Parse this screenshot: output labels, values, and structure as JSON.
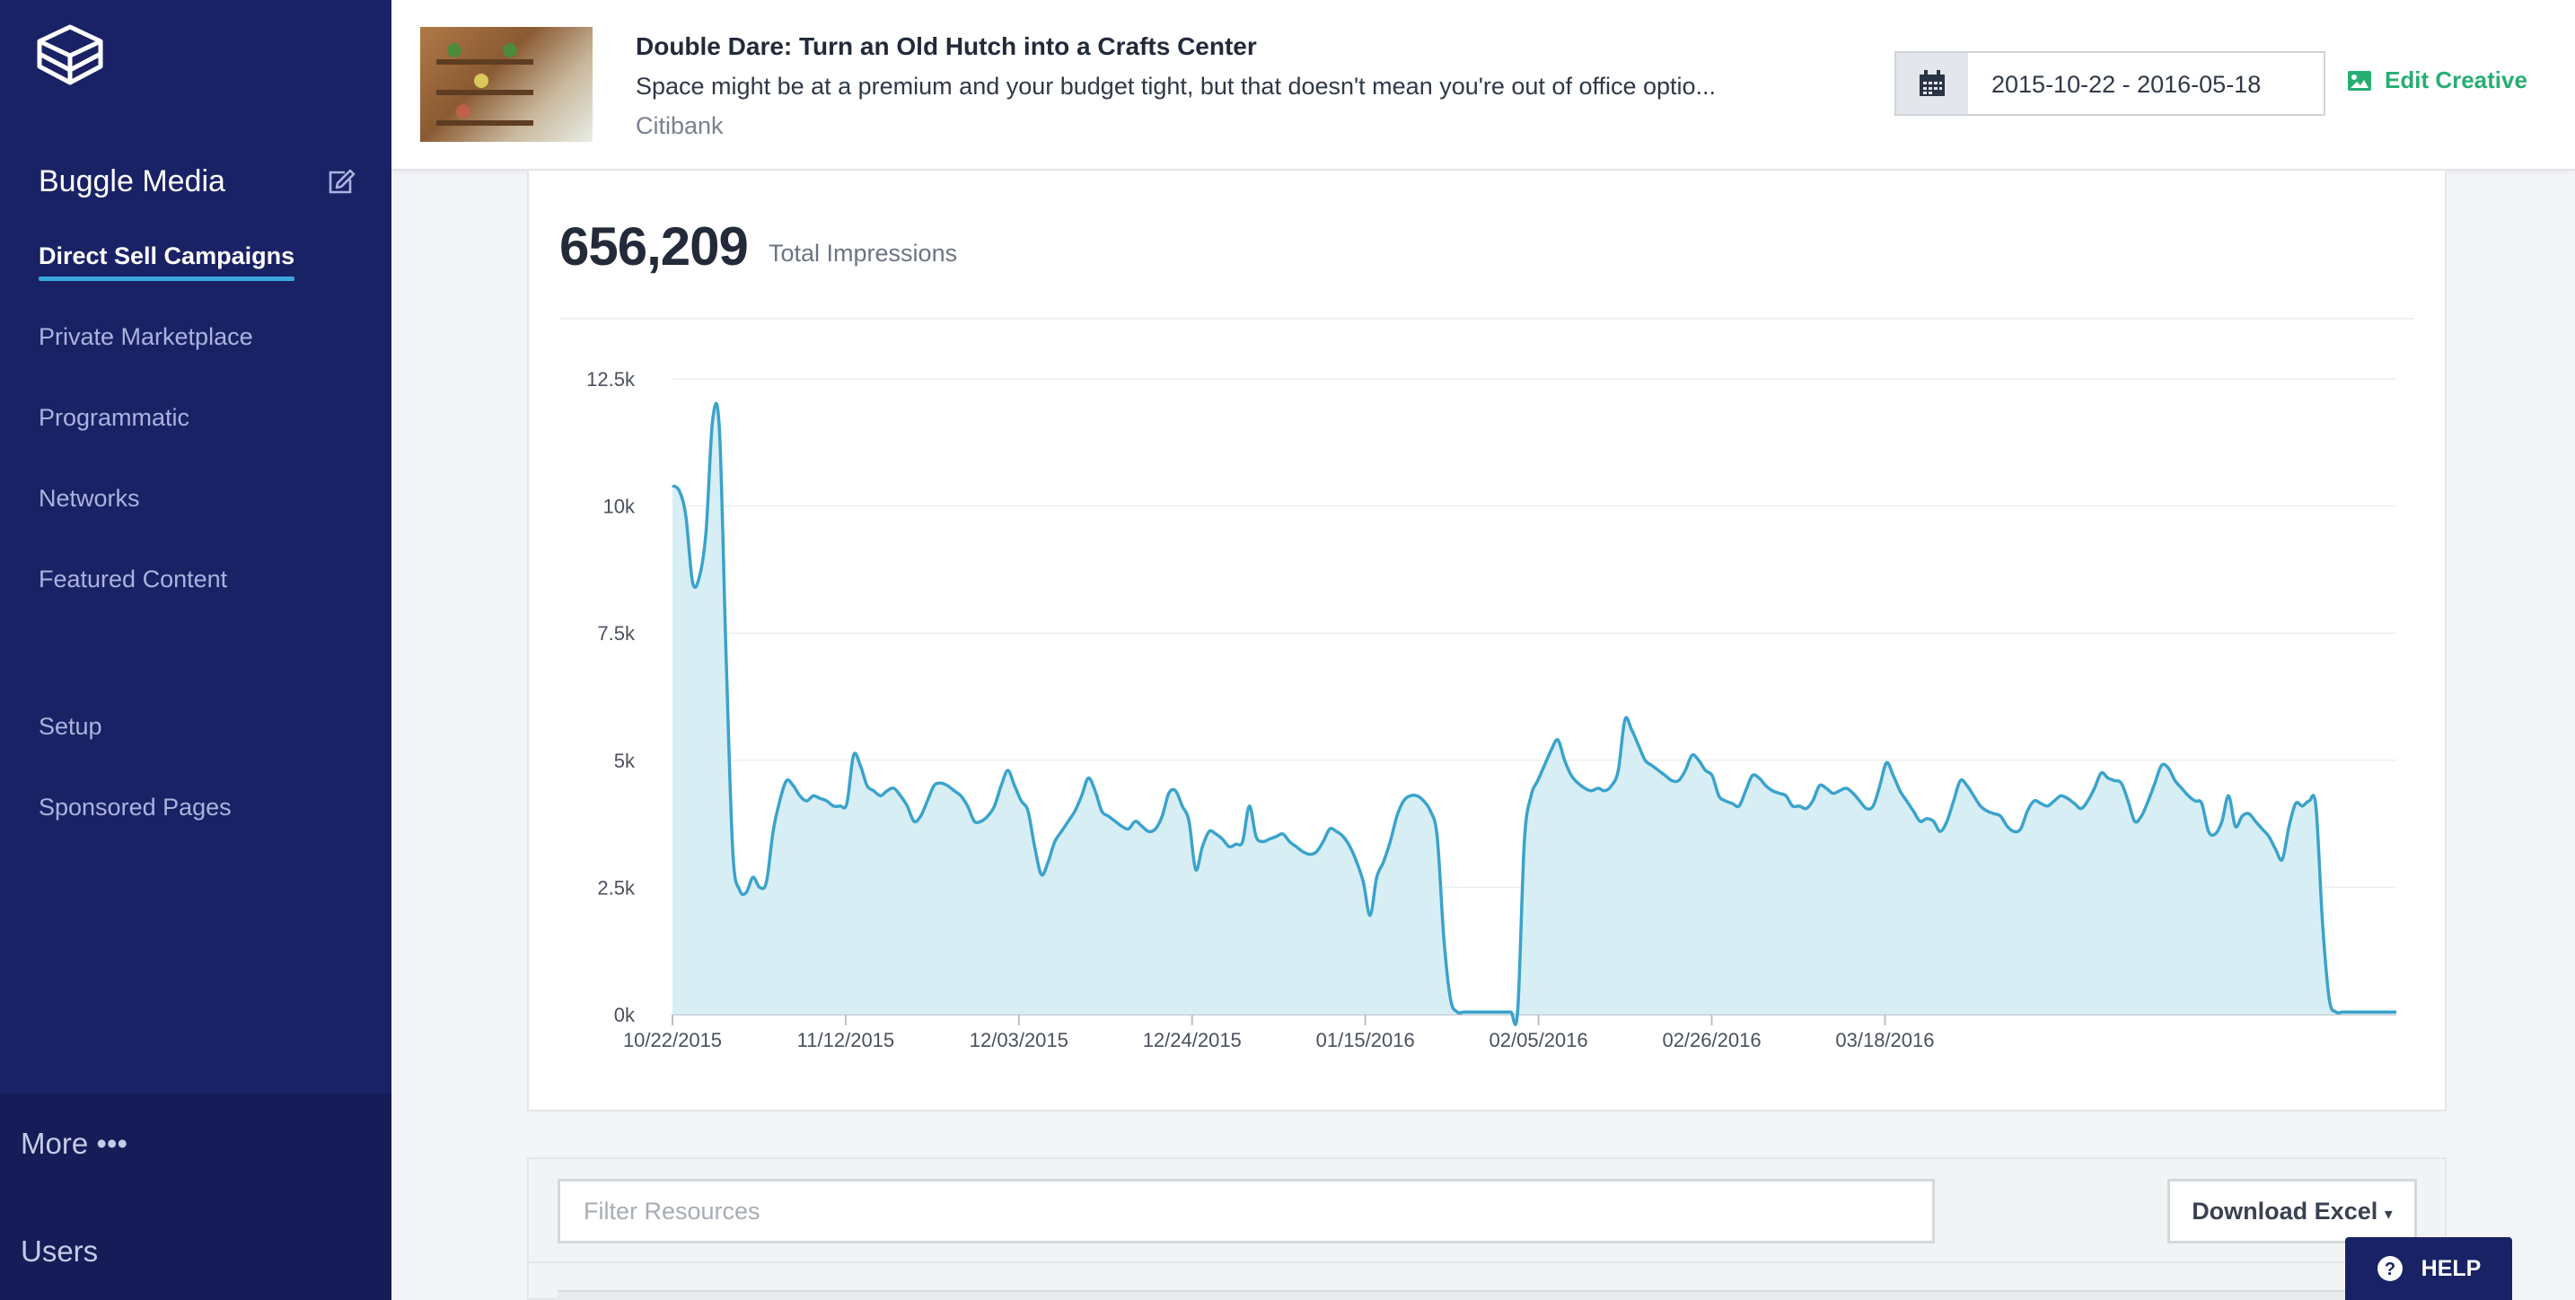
{
  "sidebar": {
    "org_name": "Buggle Media",
    "nav": [
      {
        "label": "Direct Sell Campaigns",
        "active": true
      },
      {
        "label": "Private Marketplace",
        "active": false
      },
      {
        "label": "Programmatic",
        "active": false
      },
      {
        "label": "Networks",
        "active": false
      },
      {
        "label": "Featured Content",
        "active": false
      },
      {
        "label": "Setup",
        "active": false
      },
      {
        "label": "Sponsored Pages",
        "active": false
      }
    ],
    "more_label": "More •••",
    "users_label": "Users"
  },
  "header": {
    "title": "Double Dare: Turn an Old Hutch into a Crafts Center",
    "description": "Space might be at a premium and your budget tight, but that doesn't mean you're out of office optio...",
    "advertiser": "Citibank",
    "date_range": "2015-10-22 - 2016-05-18",
    "edit_label": "Edit Creative"
  },
  "stats": {
    "total": "656,209",
    "total_label": "Total Impressions"
  },
  "chart_data": {
    "type": "area",
    "title": "",
    "xlabel": "",
    "ylabel": "",
    "ylim": [
      0,
      12500
    ],
    "yticks": [
      "0k",
      "2.5k",
      "5k",
      "7.5k",
      "10k",
      "12.5k"
    ],
    "xticks": [
      "10/22/2015",
      "11/12/2015",
      "12/03/2015",
      "12/24/2015",
      "01/15/2016",
      "02/05/2016",
      "02/26/2016",
      "03/18/2016"
    ],
    "x_start": "2015-10-22",
    "x_end": "2016-05-18",
    "series": [
      {
        "color": "#3aa3cc",
        "fill": "#d8eef5",
        "values": [
          10400,
          10300,
          9800,
          8500,
          8600,
          9500,
          11700,
          11500,
          7000,
          3200,
          2450,
          2400,
          2700,
          2500,
          2600,
          3600,
          4200,
          4600,
          4500,
          4300,
          4200,
          4300,
          4250,
          4200,
          4100,
          4100,
          4150,
          5100,
          4900,
          4500,
          4400,
          4300,
          4400,
          4450,
          4300,
          4100,
          3800,
          3900,
          4200,
          4500,
          4550,
          4500,
          4400,
          4300,
          4100,
          3800,
          3800,
          3900,
          4100,
          4500,
          4800,
          4500,
          4200,
          4000,
          3300,
          2750,
          3000,
          3400,
          3600,
          3800,
          4000,
          4300,
          4650,
          4400,
          4000,
          3900,
          3800,
          3700,
          3650,
          3800,
          3700,
          3600,
          3650,
          3900,
          4350,
          4400,
          4100,
          3800,
          2850,
          3300,
          3600,
          3550,
          3450,
          3300,
          3350,
          3400,
          4100,
          3500,
          3400,
          3450,
          3500,
          3550,
          3400,
          3300,
          3200,
          3150,
          3200,
          3400,
          3650,
          3600,
          3500,
          3300,
          3000,
          2600,
          1950,
          2700,
          3000,
          3400,
          3900,
          4200,
          4300,
          4300,
          4200,
          4000,
          3500,
          1500,
          300,
          50,
          50,
          50,
          50,
          50,
          50,
          50,
          50,
          50,
          50,
          3400,
          4300,
          4600,
          4900,
          5200,
          5400,
          5000,
          4700,
          4550,
          4450,
          4400,
          4450,
          4400,
          4500,
          4800,
          5800,
          5600,
          5300,
          5000,
          4900,
          4800,
          4700,
          4600,
          4600,
          4800,
          5100,
          5000,
          4800,
          4700,
          4300,
          4200,
          4150,
          4100,
          4400,
          4700,
          4650,
          4500,
          4400,
          4350,
          4300,
          4100,
          4100,
          4050,
          4200,
          4500,
          4450,
          4350,
          4400,
          4450,
          4350,
          4200,
          4050,
          4100,
          4500,
          4950,
          4700,
          4400,
          4200,
          4000,
          3800,
          3850,
          3800,
          3600,
          3800,
          4200,
          4600,
          4500,
          4300,
          4100,
          4000,
          3950,
          3900,
          3700,
          3600,
          3650,
          4000,
          4200,
          4150,
          4100,
          4200,
          4300,
          4250,
          4150,
          4050,
          4200,
          4450,
          4750,
          4650,
          4600,
          4550,
          4200,
          3800,
          3900,
          4200,
          4550,
          4900,
          4850,
          4600,
          4450,
          4300,
          4200,
          4150,
          3600,
          3550,
          3800,
          4300,
          3700,
          3900,
          3950,
          3800,
          3650,
          3500,
          3250,
          3050,
          3700,
          4150,
          4100,
          4200,
          4100,
          1800,
          300,
          50,
          50,
          50,
          50,
          50,
          50,
          50,
          50,
          50,
          50
        ]
      }
    ]
  },
  "filter": {
    "placeholder": "Filter Resources",
    "download_label": "Download Excel"
  },
  "help_label": "HELP"
}
